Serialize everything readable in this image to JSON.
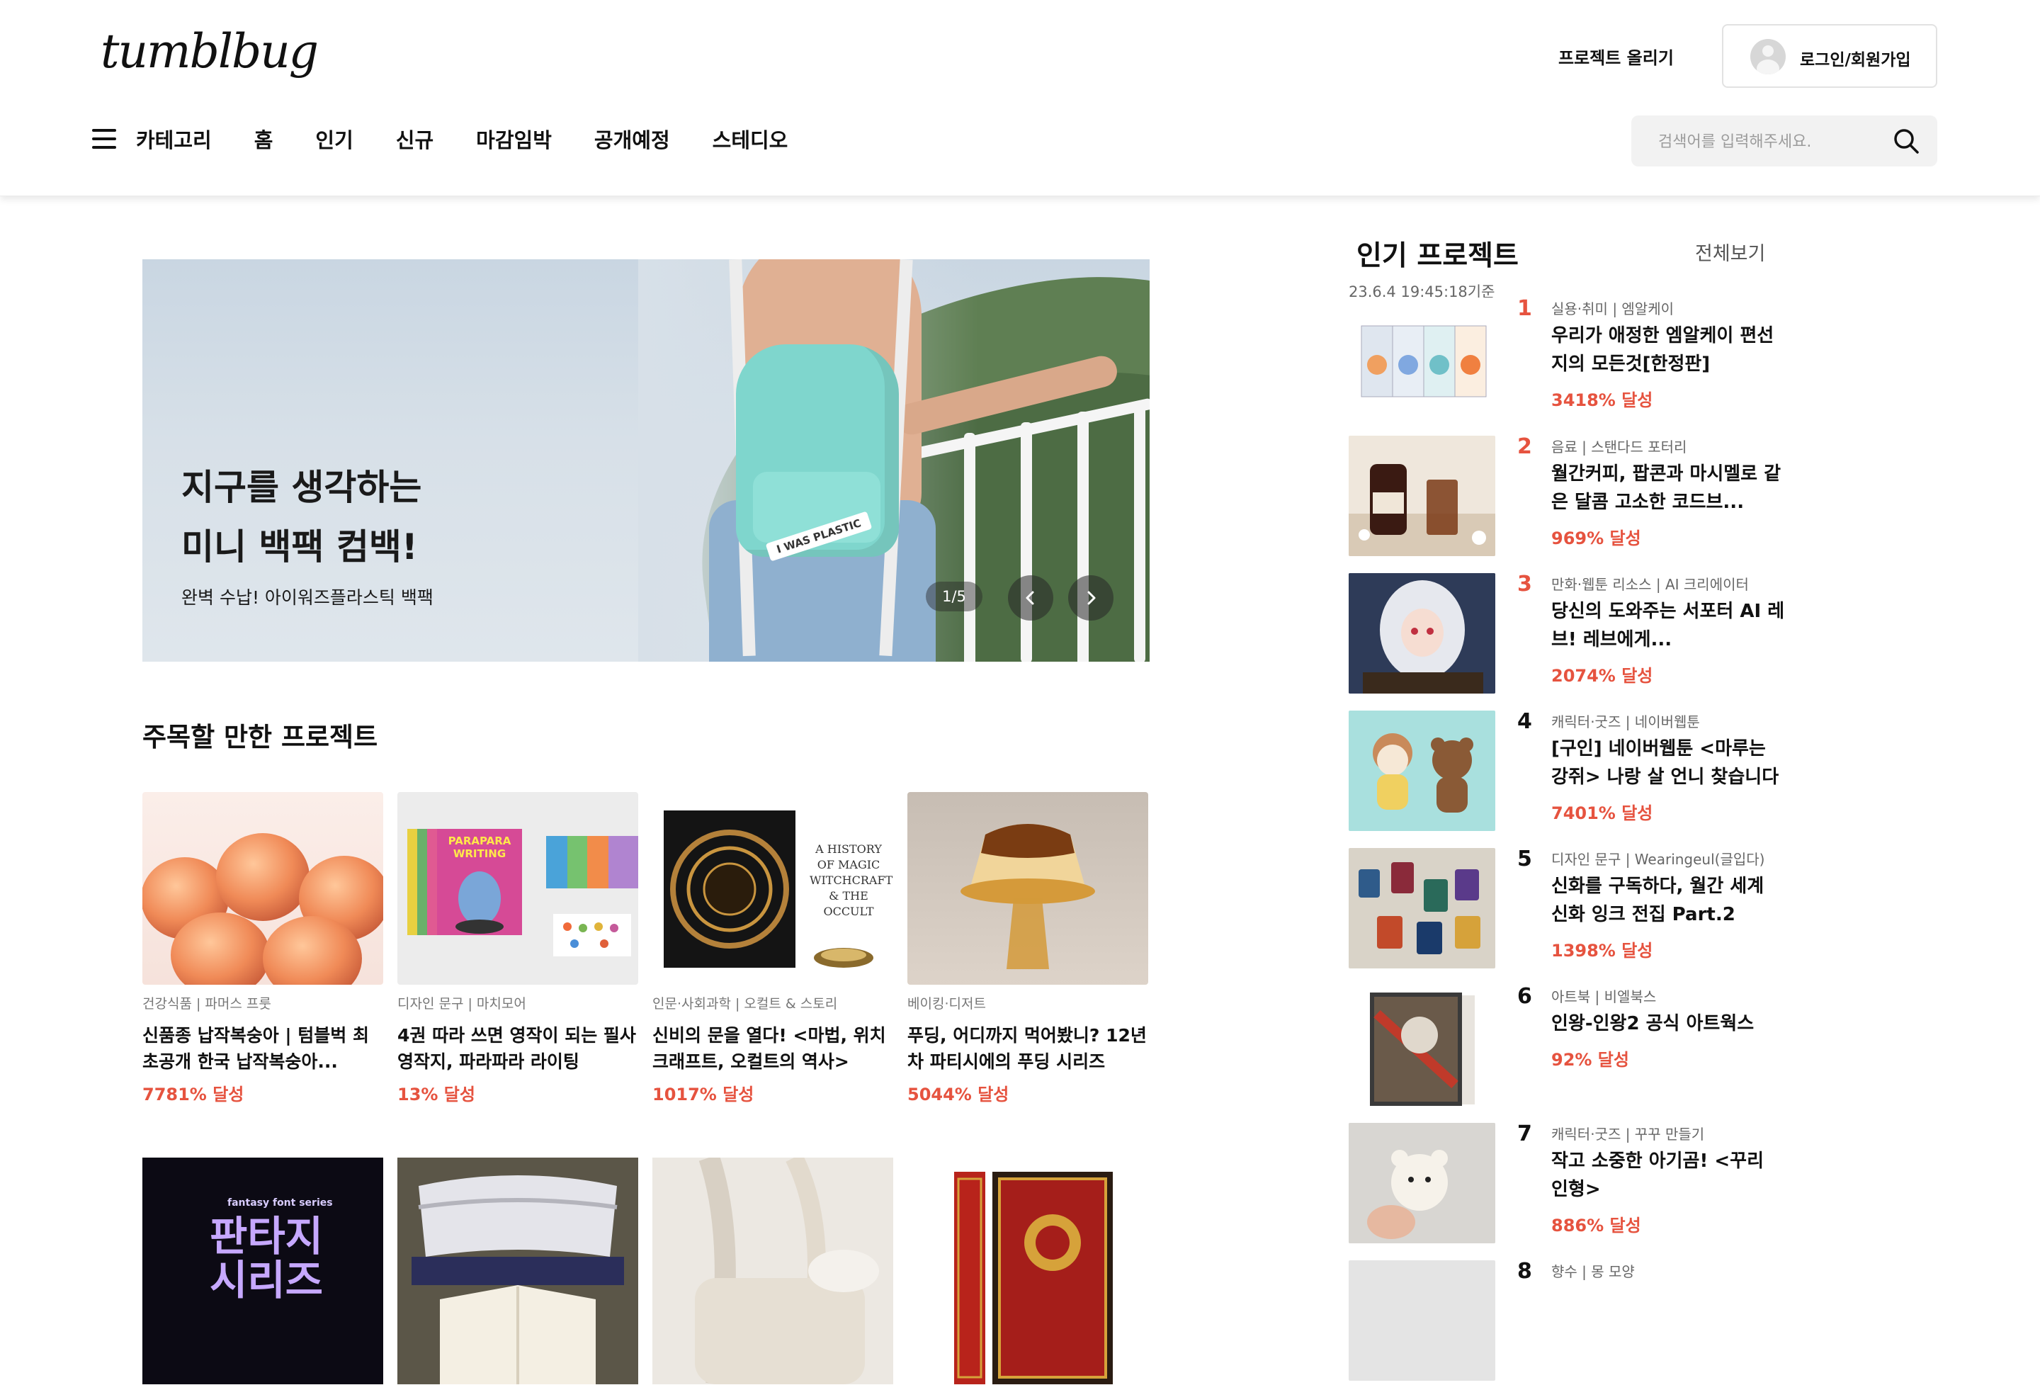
{
  "header": {
    "logo": "tumblbug",
    "upload_label": "프로젝트 올리기",
    "login_label": "로그인/회원가입",
    "nav": [
      "카테고리",
      "홈",
      "인기",
      "신규",
      "마감임박",
      "공개예정",
      "스테디오"
    ],
    "search_placeholder": "검색어를 입력해주세요."
  },
  "hero": {
    "title": "지구를 생각하는\n미니 백팩 컴백!",
    "subtitle": "완벽 수납! 아이워즈플라스틱 백팩",
    "counter": "1/5",
    "bag_tag": "I WAS PLASTIC"
  },
  "featured": {
    "title": "주목할 만한 프로젝트",
    "cards": [
      {
        "category": "건강식품 | 파머스 프룻",
        "title": "신품종 납작복숭아 | 텀블벅 최초공개 한국 납작복숭아...",
        "rate": "7781% 달성"
      },
      {
        "category": "디자인 문구 | 마치모어",
        "title": "4권 따라 쓰면 영작이 되는 필사 영작지, 파라파라 라이팅",
        "rate": "13% 달성"
      },
      {
        "category": "인문·사회과학 | 오컬트 & 스토리",
        "title": "신비의 문을 열다! <마법, 위치크래프트, 오컬트의 역사>",
        "rate": "1017% 달성"
      },
      {
        "category": "베이킹·디저트",
        "title": "푸딩, 어디까지 먹어봤니? 12년차 파티시에의 푸딩 시리즈",
        "rate": "5044% 달성"
      }
    ],
    "thumb_texts": {
      "parapara": "PARAPARA WRITING",
      "magic": "A HISTORY OF MAGIC WITCHCRAFT & THE OCCULT",
      "fantasy_series": "fantasy font series",
      "fantasy": "판타지 시리즈"
    }
  },
  "popular": {
    "title": "인기 프로젝트",
    "view_all": "전체보기",
    "timestamp": "23.6.4 19:45:18기준",
    "items": [
      {
        "rank": "1",
        "category": "실용·취미 | 엠알케이",
        "title": "우리가 애정한 엠알케이 편선지의 모든것[한정판]",
        "rate": "3418% 달성"
      },
      {
        "rank": "2",
        "category": "음료 | 스탠다드 포터리",
        "title": "월간커피, 팝콘과 마시멜로 같은 달콤 고소한 코드브...",
        "rate": "969% 달성"
      },
      {
        "rank": "3",
        "category": "만화·웹툰 리소스 | AI 크리에이터",
        "title": "당신의 도와주는 서포터 AI 레브! 레브에게...",
        "rate": "2074% 달성"
      },
      {
        "rank": "4",
        "category": "캐릭터·굿즈 | 네이버웹툰",
        "title": "[구인] 네이버웹툰 <마루는 강쥐> 나랑 살 언니 찾습니다",
        "rate": "7401% 달성"
      },
      {
        "rank": "5",
        "category": "디자인 문구 | Wearingeul(글입다)",
        "title": "신화를 구독하다, 월간 세계 신화 잉크 전집 Part.2",
        "rate": "1398% 달성"
      },
      {
        "rank": "6",
        "category": "아트북 | 비엘북스",
        "title": "인왕-인왕2 공식 아트웍스",
        "rate": "92% 달성"
      },
      {
        "rank": "7",
        "category": "캐릭터·굿즈 | 꾸꾸 만들기",
        "title": "작고 소중한 아기곰! <꾸리 인형>",
        "rate": "886% 달성"
      },
      {
        "rank": "8",
        "category": "향수 | 몽 모양",
        "title": "",
        "rate": ""
      }
    ]
  },
  "colors": {
    "accent": "#e6533f",
    "text": "#111111",
    "muted": "#777777",
    "search_bg": "#f2f2f2"
  }
}
